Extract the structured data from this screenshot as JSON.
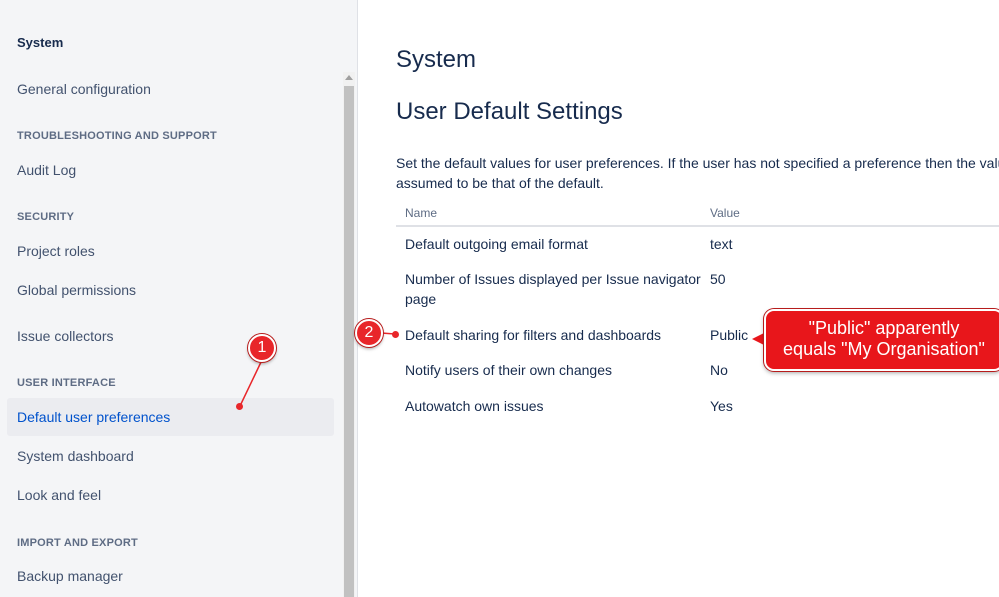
{
  "sidebar": {
    "heading": "System",
    "items": [
      {
        "label": "General configuration"
      },
      {
        "section": "TROUBLESHOOTING AND SUPPORT"
      },
      {
        "label": "Audit Log"
      },
      {
        "section": "SECURITY"
      },
      {
        "label": "Project roles"
      },
      {
        "label": "Global permissions"
      },
      {
        "label": "Issue collectors"
      },
      {
        "section": "USER INTERFACE"
      },
      {
        "label": "Default user preferences",
        "active": true
      },
      {
        "label": "System dashboard"
      },
      {
        "label": "Look and feel"
      },
      {
        "section": "IMPORT AND EXPORT"
      },
      {
        "label": "Backup manager"
      }
    ]
  },
  "main": {
    "page_title": "System",
    "section_title": "User Default Settings",
    "description": "Set the default values for user preferences. If the user has not specified a preference then the value is assumed to be that of the default.",
    "table": {
      "headers": [
        "Name",
        "Value"
      ],
      "rows": [
        {
          "name": "Default outgoing email format",
          "value": "text"
        },
        {
          "name": "Number of Issues displayed per Issue navigator page",
          "value": "50"
        },
        {
          "name": "Default sharing for filters and dashboards",
          "value": "Public"
        },
        {
          "name": "Notify users of their own changes",
          "value": "No"
        },
        {
          "name": "Autowatch own issues",
          "value": "Yes"
        }
      ]
    }
  },
  "annotations": {
    "marker1": "1",
    "marker2": "2",
    "callout_line1": "\"Public\" apparently",
    "callout_line2": "equals \"My Organisation\""
  },
  "colors": {
    "accent": "#0052cc",
    "annotation_red": "#e8262a"
  }
}
